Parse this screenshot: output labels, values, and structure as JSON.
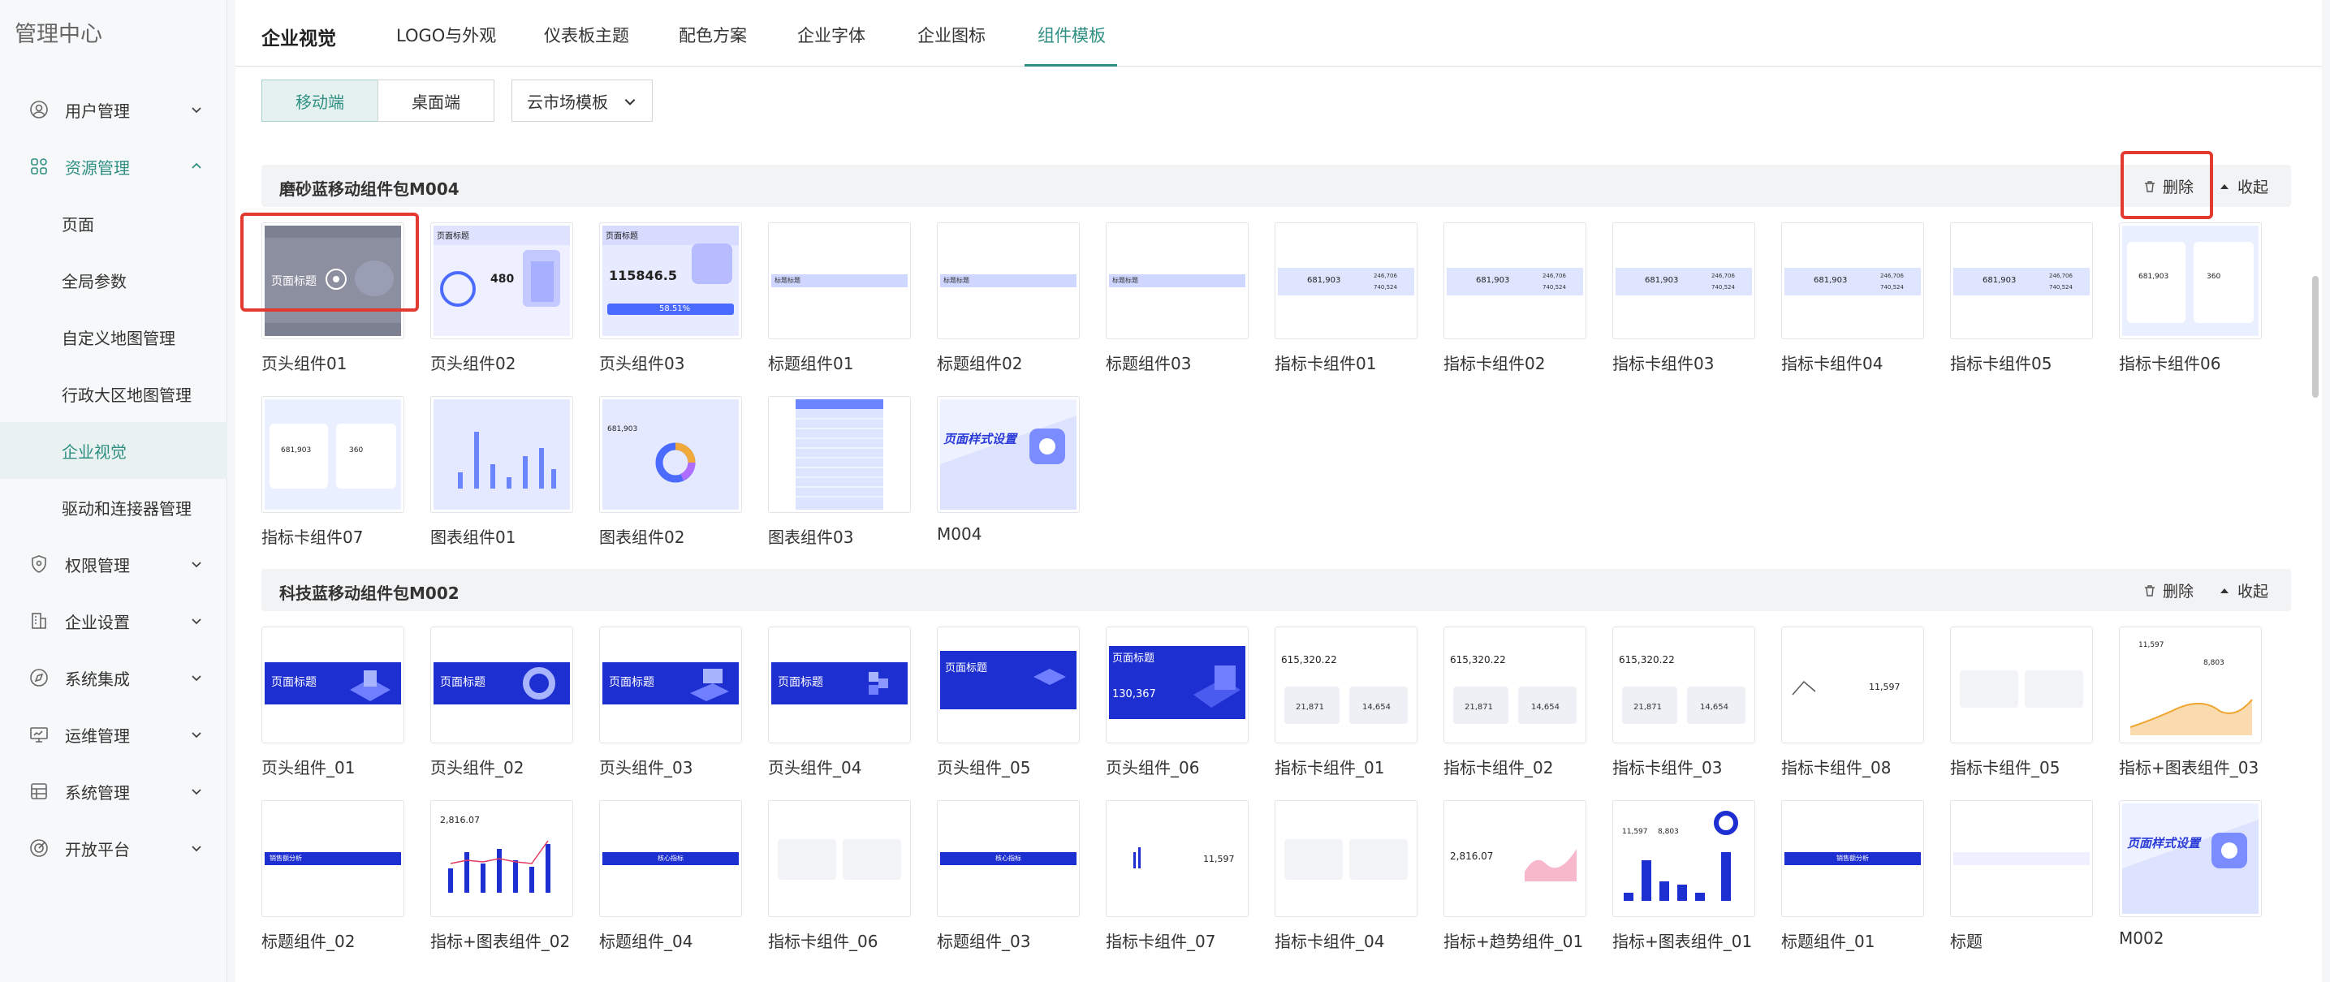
{
  "sidebar": {
    "title": "管理中心",
    "items": [
      {
        "label": "用户管理",
        "icon": "user-circle-icon"
      },
      {
        "label": "资源管理",
        "icon": "grid-icon"
      },
      {
        "label": "权限管理",
        "icon": "shield-icon"
      },
      {
        "label": "企业设置",
        "icon": "building-icon"
      },
      {
        "label": "系统集成",
        "icon": "compass-icon"
      },
      {
        "label": "运维管理",
        "icon": "monitor-icon"
      },
      {
        "label": "系统管理",
        "icon": "layers-icon"
      },
      {
        "label": "开放平台",
        "icon": "radar-icon"
      }
    ],
    "sub_items": [
      "页面",
      "全局参数",
      "自定义地图管理",
      "行政大区地图管理",
      "企业视觉",
      "驱动和连接器管理"
    ]
  },
  "tabs": {
    "brand": "企业视觉",
    "items": [
      "LOGO与外观",
      "仪表板主题",
      "配色方案",
      "企业字体",
      "企业图标",
      "组件模板"
    ],
    "active": "组件模板"
  },
  "toolbar": {
    "mobile": "移动端",
    "desktop": "桌面端",
    "dropdown": "云市场模板"
  },
  "colors": {
    "accent": "#2f8f83",
    "highlight": "#e23a30",
    "blue": "#1e2fd1"
  },
  "section1": {
    "name": "磨砂蓝移动组件包M004",
    "delete": "删除",
    "collapse": "收起",
    "cards": [
      "页头组件01",
      "页头组件02",
      "页头组件03",
      "标题组件01",
      "标题组件02",
      "标题组件03",
      "指标卡组件01",
      "指标卡组件02",
      "指标卡组件03",
      "指标卡组件04",
      "指标卡组件05",
      "指标卡组件06",
      "指标卡组件07",
      "图表组件01",
      "图表组件02",
      "图表组件03",
      "M004"
    ],
    "thumb": {
      "page_title": "页面标题",
      "v480": "480",
      "v115": "115846.5",
      "pct": "58.51%",
      "bar": "标题标题",
      "n1": "681,903",
      "n2": "246,706",
      "n3": "740,524",
      "n4": "360",
      "cover": "页面样式设置"
    }
  },
  "section2": {
    "name": "科技蓝移动组件包M002",
    "delete": "删除",
    "collapse": "收起",
    "cards": [
      "页头组件_01",
      "页头组件_02",
      "页头组件_03",
      "页头组件_04",
      "页头组件_05",
      "页头组件_06",
      "指标卡组件_01",
      "指标卡组件_02",
      "指标卡组件_03",
      "指标卡组件_08",
      "指标卡组件_05",
      "指标+图表组件_03",
      "标题组件_02",
      "指标+图表组件_02",
      "标题组件_04",
      "指标卡组件_06",
      "标题组件_03",
      "指标卡组件_07",
      "指标卡组件_04",
      "指标+趋势组件_01",
      "指标+图表组件_01",
      "标题组件_01",
      "标题",
      "M002"
    ],
    "thumb": {
      "page_title": "页面标题",
      "v615": "615,320.22",
      "v21": "21,871",
      "v14": "14,654",
      "v11597": "11,597",
      "v130": "130,367",
      "v2816": "2,816.07",
      "v8803": "8,803",
      "cover": "页面样式设置",
      "title_bar": "销售额分析",
      "core": "核心指标"
    }
  }
}
